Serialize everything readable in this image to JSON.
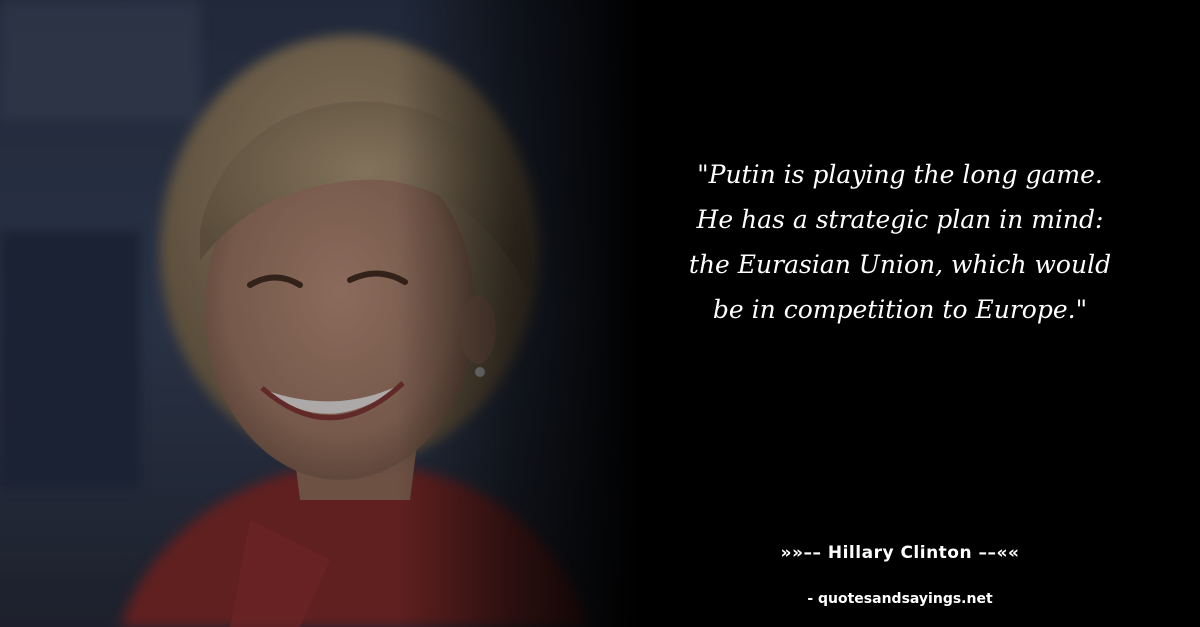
{
  "quote": {
    "text": "\"Putin is playing the long game. He has a strategic plan in mind: the Eurasian Union, which would be in competition to Europe.\""
  },
  "author": {
    "label": "»»–– Hillary Clinton ––««"
  },
  "source": {
    "label": "- quotesandsayings.net"
  },
  "photo": {
    "icon": "portrait-photo"
  },
  "colors": {
    "background": "#000000",
    "text": "#ffffff",
    "jacket": "#8a2d2f",
    "hair": "#a89270",
    "skin": "#b98c77",
    "backdrop": "#3b4863"
  }
}
